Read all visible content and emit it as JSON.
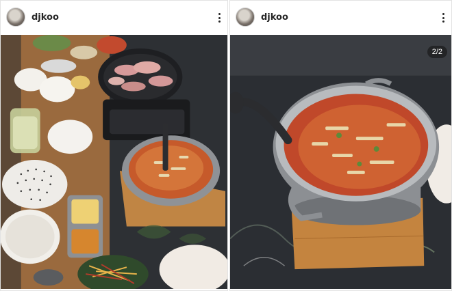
{
  "posts": [
    {
      "username": "djkoo",
      "menu_icon": "more-vertical-icon"
    },
    {
      "username": "djkoo",
      "menu_icon": "more-vertical-icon",
      "carousel_counter": "2/2"
    }
  ],
  "colors": {
    "header_bg": "#ffffff",
    "username_text": "#262626",
    "table_dark": "#2f3236",
    "stew_red": "#c9552a",
    "pot_steel": "#a5a8ab",
    "wood_board": "#b8783b"
  }
}
